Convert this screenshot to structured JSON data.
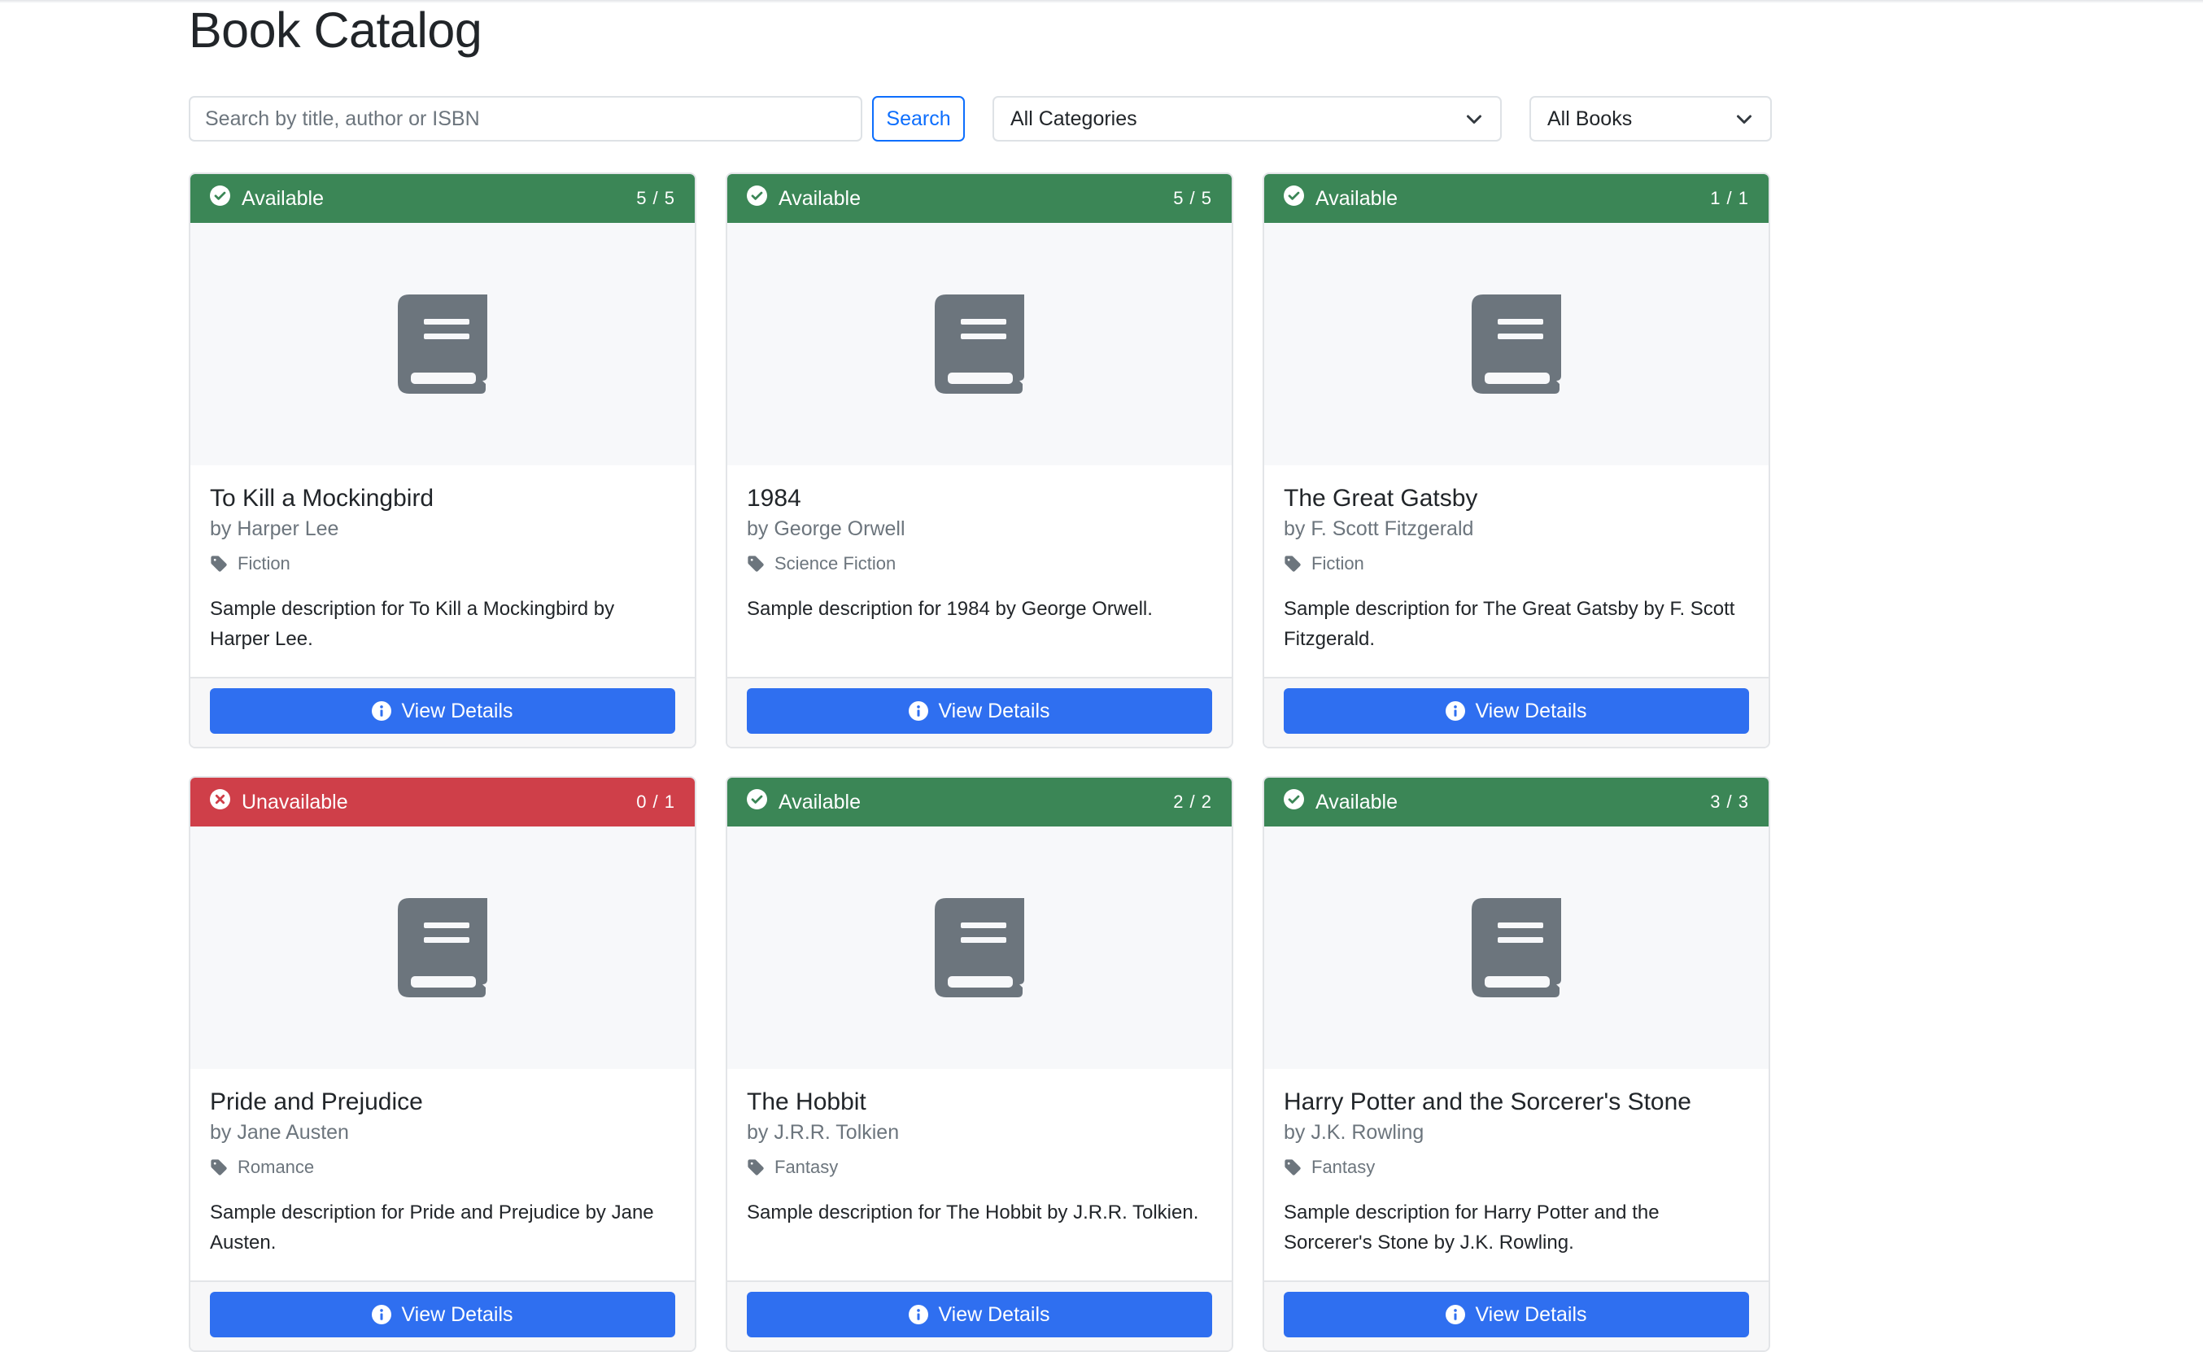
{
  "page": {
    "title": "Book Catalog"
  },
  "toolbar": {
    "search_placeholder": "Search by title, author or ISBN",
    "search_value": "",
    "search_button": "Search",
    "category_select": "All Categories",
    "availability_select": "All Books"
  },
  "colors": {
    "available": "#3b8656",
    "unavailable": "#cf3f49",
    "primary": "#2f6ff0"
  },
  "books": [
    {
      "status": "Available",
      "available": true,
      "count": "5 / 5",
      "title": "To Kill a Mockingbird",
      "author": "by Harper Lee",
      "category": "Fiction",
      "description": "Sample description for To Kill a Mockingbird by Harper Lee.",
      "button": "View Details"
    },
    {
      "status": "Available",
      "available": true,
      "count": "5 / 5",
      "title": "1984",
      "author": "by George Orwell",
      "category": "Science Fiction",
      "description": "Sample description for 1984 by George Orwell.",
      "button": "View Details"
    },
    {
      "status": "Available",
      "available": true,
      "count": "1 / 1",
      "title": "The Great Gatsby",
      "author": "by F. Scott Fitzgerald",
      "category": "Fiction",
      "description": "Sample description for The Great Gatsby by F. Scott Fitzgerald.",
      "button": "View Details"
    },
    {
      "status": "Unavailable",
      "available": false,
      "count": "0 / 1",
      "title": "Pride and Prejudice",
      "author": "by Jane Austen",
      "category": "Romance",
      "description": "Sample description for Pride and Prejudice by Jane Austen.",
      "button": "View Details"
    },
    {
      "status": "Available",
      "available": true,
      "count": "2 / 2",
      "title": "The Hobbit",
      "author": "by J.R.R. Tolkien",
      "category": "Fantasy",
      "description": "Sample description for The Hobbit by J.R.R. Tolkien.",
      "button": "View Details"
    },
    {
      "status": "Available",
      "available": true,
      "count": "3 / 3",
      "title": "Harry Potter and the Sorcerer's Stone",
      "author": "by J.K. Rowling",
      "category": "Fantasy",
      "description": "Sample description for Harry Potter and the Sorcerer's Stone by J.K. Rowling.",
      "button": "View Details"
    }
  ]
}
